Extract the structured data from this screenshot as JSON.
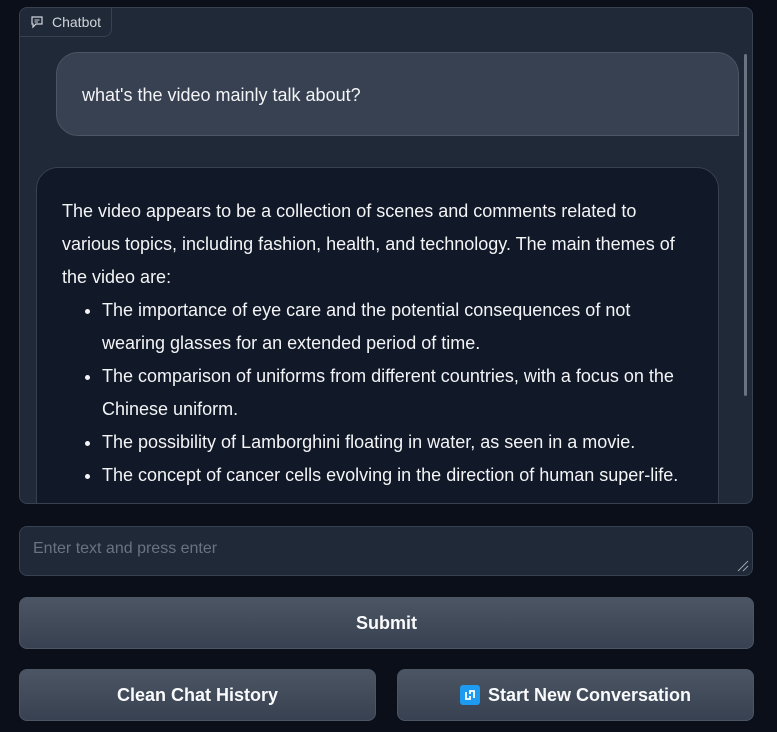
{
  "chatbot": {
    "label": "Chatbot",
    "icon": "chat-bubble-icon",
    "messages": [
      {
        "role": "user",
        "text": "what's the video mainly talk about?"
      },
      {
        "role": "bot",
        "intro": "The video appears to be a collection of scenes and comments related to various topics, including fashion, health, and technology. The main themes of the video are:",
        "bullets": [
          "The importance of eye care and the potential consequences of not wearing glasses for an extended period of time.",
          "The comparison of uniforms from different countries, with a focus on the Chinese uniform.",
          "The possibility of Lamborghini floating in water, as seen in a movie.",
          "The concept of cancer cells evolving in the direction of human super-life."
        ]
      }
    ]
  },
  "input": {
    "placeholder": "Enter text and press enter",
    "value": ""
  },
  "buttons": {
    "submit": "Submit",
    "clean": "Clean Chat History",
    "new_conversation": "Start New Conversation",
    "new_conversation_icon": "refresh-icon"
  },
  "colors": {
    "background": "#0b0f19",
    "panel": "#1f2937",
    "user_bubble": "#374151",
    "bot_bubble": "#111827",
    "accent_icon": "#1d9bf0"
  }
}
